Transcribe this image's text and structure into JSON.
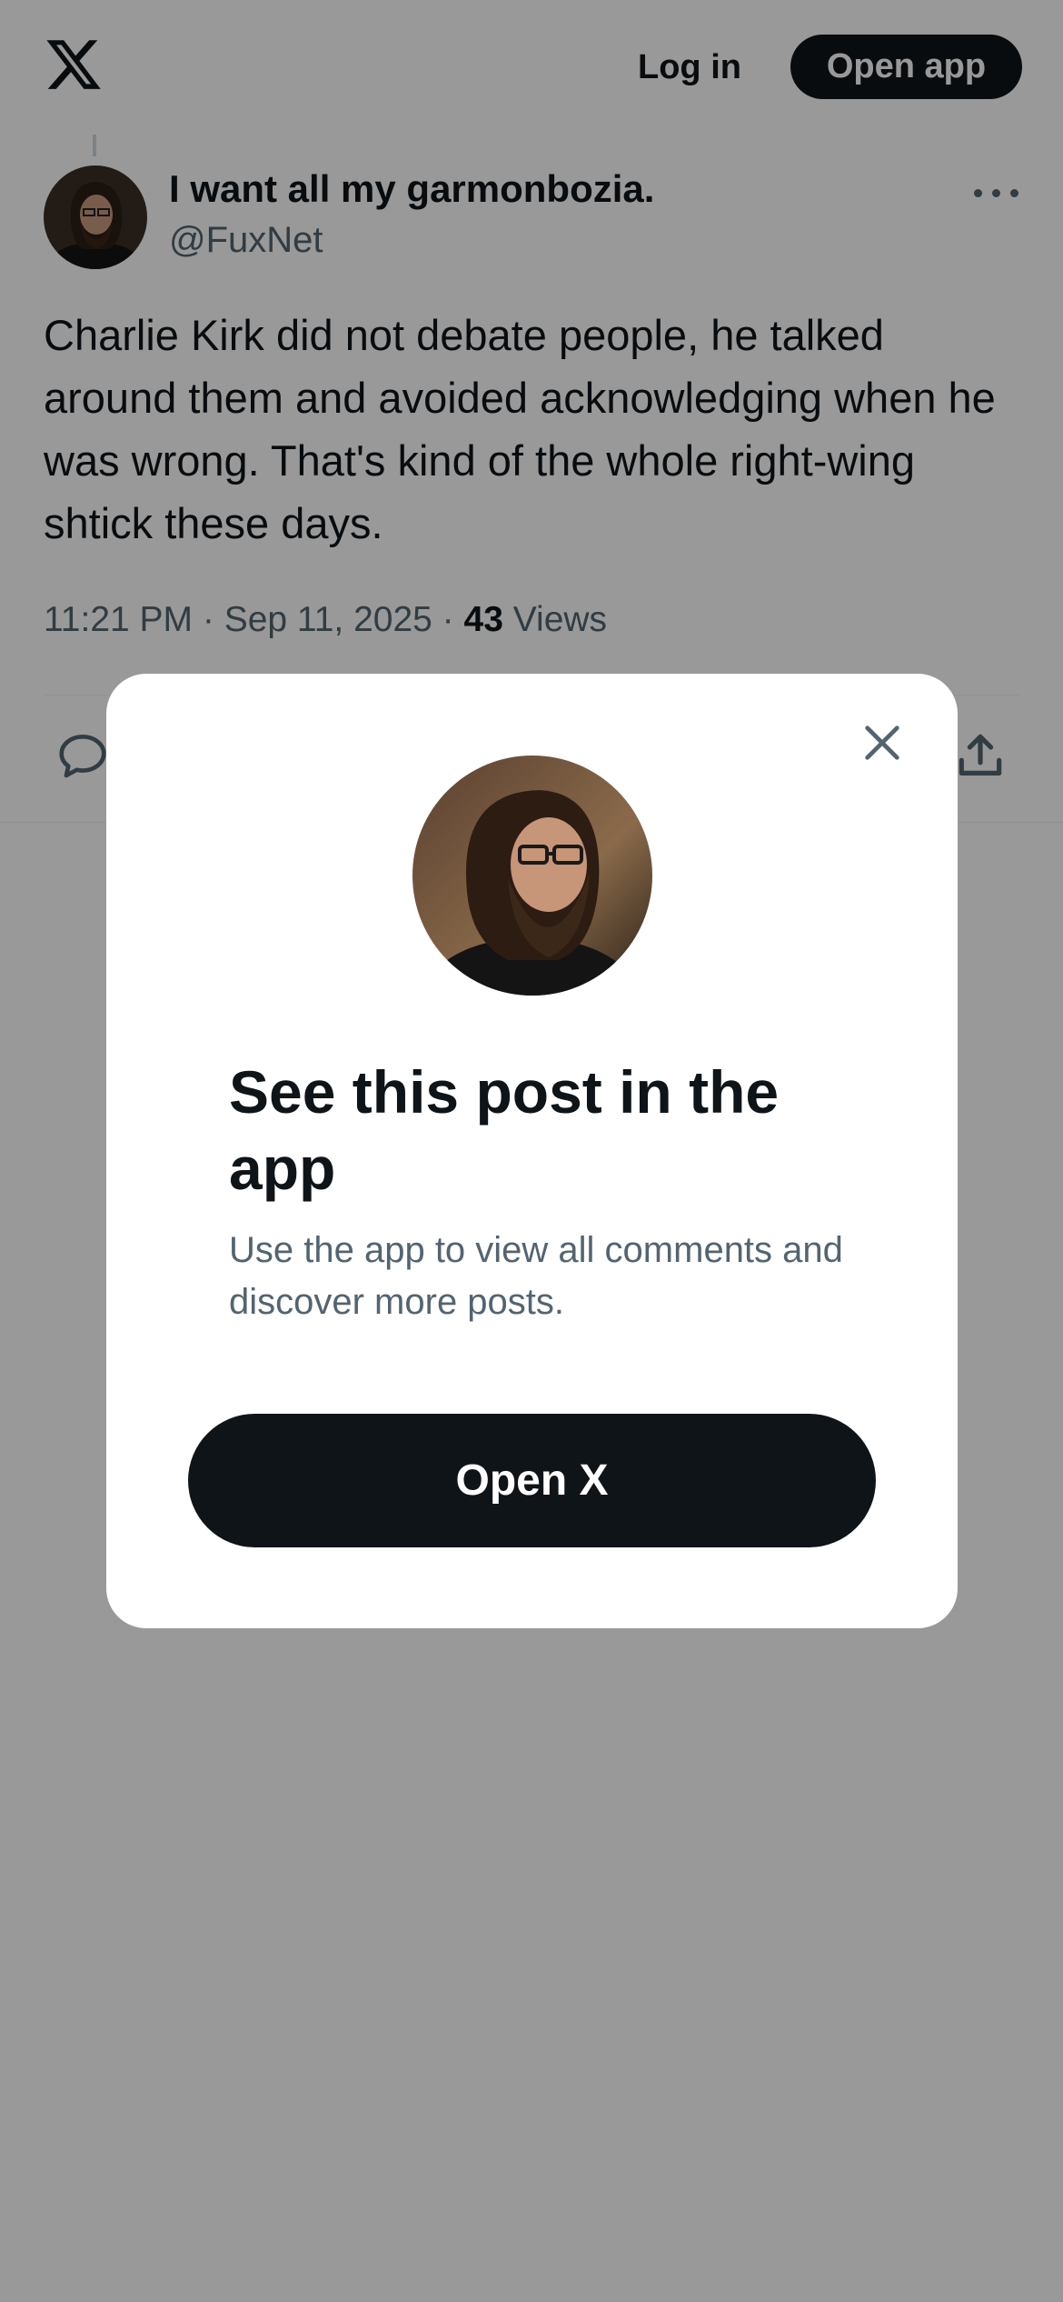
{
  "header": {
    "logo_icon": "x-logo-icon",
    "login_label": "Log in",
    "open_app_label": "Open app"
  },
  "tweet": {
    "display_name": "I want all my garmonbozia.",
    "handle": "@FuxNet",
    "text": "Charlie Kirk did not debate people, he talked around them and avoided acknowledging when he was wrong. That's kind of the whole right-wing shtick these days.",
    "time": "11:21 PM · Sep 11, 2025 · ",
    "views_count": "43",
    "views_label": " Views",
    "more_icon": "more-horizontal-icon",
    "actions": [
      "reply-icon",
      "share-icon"
    ]
  },
  "modal": {
    "title": "See this post in the app",
    "subtitle": "Use the app to view all comments and discover more posts.",
    "button_label": "Open X",
    "close_icon": "close-icon"
  },
  "colors": {
    "overlay": "rgba(0,0,0,0.4)",
    "primary_dark": "#0f1419",
    "secondary_text": "#536471"
  }
}
